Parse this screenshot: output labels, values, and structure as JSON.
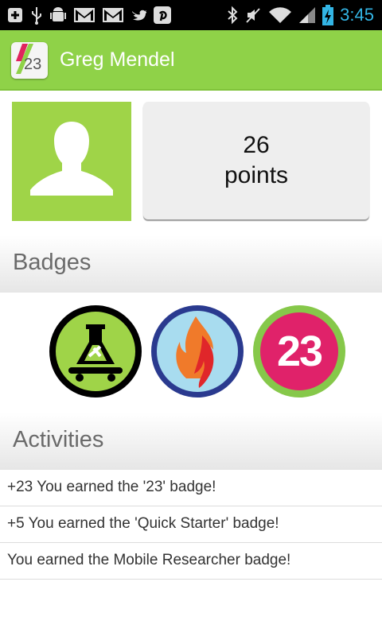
{
  "status_bar": {
    "time": "3:45",
    "icons": [
      "notification-plus-icon",
      "usb-icon",
      "android-debug-icon",
      "gmail-icon",
      "gmail-icon",
      "twitter-icon",
      "pinterest-icon",
      "bluetooth-icon",
      "mute-icon",
      "wifi-icon",
      "signal-icon",
      "battery-charging-icon"
    ],
    "time_color": "#33b5e5"
  },
  "app_bar": {
    "logo_text": "23",
    "title": "Greg Mendel",
    "color": "#8fd248"
  },
  "profile": {
    "avatar_icon": "user-silhouette-icon",
    "points_value": "26",
    "points_label": "points"
  },
  "badges_section": {
    "title": "Badges",
    "badges": [
      {
        "name": "mobile-researcher-badge",
        "icon": "flask-skateboard-icon"
      },
      {
        "name": "quick-starter-badge",
        "icon": "flame-icon"
      },
      {
        "name": "23-badge",
        "label": "23"
      }
    ]
  },
  "activities_section": {
    "title": "Activities",
    "items": [
      "+23 You earned the '23' badge!",
      "+5 You earned the 'Quick Starter' badge!",
      "You earned the Mobile Researcher badge!"
    ]
  }
}
